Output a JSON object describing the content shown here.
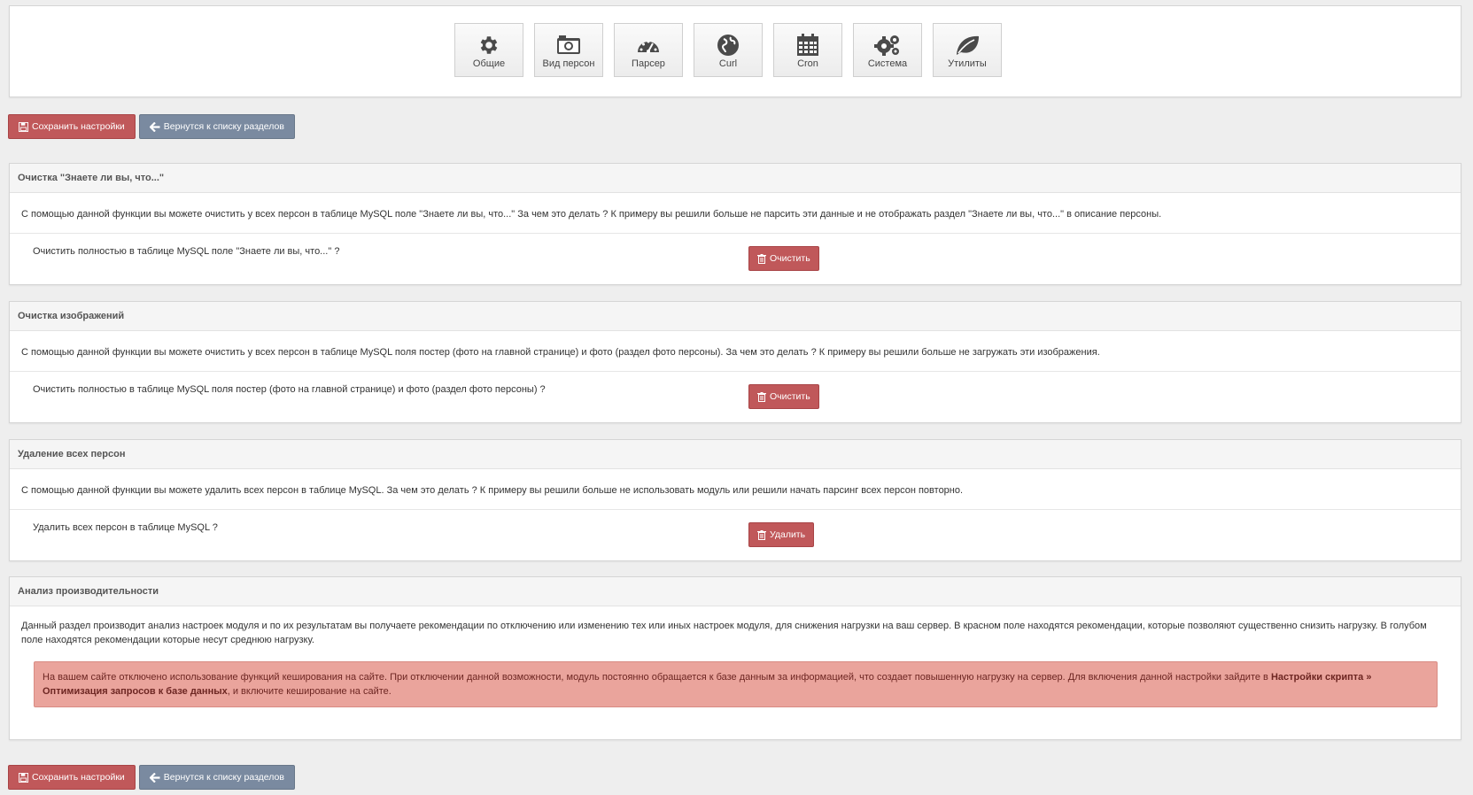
{
  "nav": [
    {
      "label": "Общие",
      "icon": "gear-icon"
    },
    {
      "label": "Вид персон",
      "icon": "camera-icon"
    },
    {
      "label": "Парсер",
      "icon": "dashboard-icon"
    },
    {
      "label": "Curl",
      "icon": "globe-icon"
    },
    {
      "label": "Cron",
      "icon": "calendar-icon"
    },
    {
      "label": "Система",
      "icon": "gears-icon"
    },
    {
      "label": "Утилиты",
      "icon": "leaf-icon"
    }
  ],
  "toolbar": {
    "save_label": "Сохранить настройки",
    "back_label": "Вернутся к списку разделов"
  },
  "sections": {
    "know": {
      "title": "Очистка \"Знаете ли вы, что...\"",
      "description": "С помощью данной функции вы можете очистить у всех персон в таблице MySQL поле \"Знаете ли вы, что...\" За чем это делать ? К примеру вы решили больше не парсить эти данные и не отображать раздел \"Знаете ли вы, что...\" в описание персоны.",
      "question": "Очистить полностью в таблице MySQL поле \"Знаете ли вы, что...\" ?",
      "action_label": "Очистить"
    },
    "images": {
      "title": "Очистка изображений",
      "description": "С помощью данной функции вы можете очистить у всех персон в таблице MySQL поля постер (фото на главной странице) и фото (раздел фото персоны). За чем это делать ? К примеру вы решили больше не загружать эти изображения.",
      "question": "Очистить полностью в таблице MySQL поля постер (фото на главной странице) и фото (раздел фото персоны) ?",
      "action_label": "Очистить"
    },
    "delete": {
      "title": "Удаление всех персон",
      "description": "С помощью данной функции вы можете удалить всех персон в таблице MySQL. За чем это делать ? К примеру вы решили больше не использовать модуль или решили начать парсинг всех персон повторно.",
      "question": "Удалить всех персон в таблице MySQL ?",
      "action_label": "Удалить"
    },
    "perf": {
      "title": "Анализ производительности",
      "description": "Данный раздел производит анализ настроек модуля и по их результатам вы получаете рекомендации по отключению или изменению тех или иных настроек модуля, для снижения нагрузки на ваш сервер. В красном поле находятся рекомендации, которые позволяют существенно снизить нагрузку. В голубом поле находятся рекомендации которые несут среднюю нагрузку.",
      "alert_text": "На вашем сайте отключено использование функций кеширования на сайте. При отключении данной возможности, модуль постоянно обращается к базе данным за информацией, что создает повышенную нагрузку на сервер. Для включения данной настройки зайдите в ",
      "alert_link": "Настройки скрипта » Оптимизация запросов к базе данных",
      "alert_tail": ", и включите кеширование на сайте."
    }
  },
  "colors": {
    "danger": "#c0585a",
    "secondary": "#7a8aa0",
    "alert_bg": "#eaa49c"
  }
}
